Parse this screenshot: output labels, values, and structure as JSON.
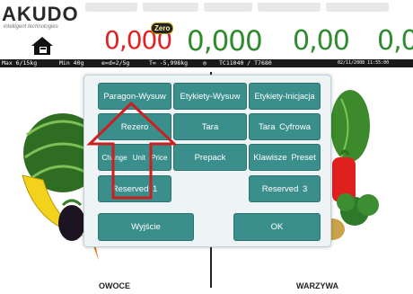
{
  "header": {
    "logo_text": "AKUDO",
    "logo_subtext": "intelligent technologies",
    "zero_badge": "Zero",
    "display_values": [
      "0,000",
      "0,000",
      "0,00",
      "0,0"
    ]
  },
  "status_bar": {
    "range": "Max 6/15kg",
    "min": "Min 40g",
    "division": "e=d=2/5g",
    "tare": "T= -5,998kg",
    "terminal": "TC11040 / T7680",
    "date": "02/11/2008 11:55:00"
  },
  "dialog": {
    "buttons": [
      "Paragon-Wysuw",
      "Etykiety-Wysuw",
      "Etykiety-Inicjacja",
      "Rezero",
      "Tara",
      "Tara Cyfrowa",
      "Change Unit Price",
      "Prepack",
      "Klawisze Preset",
      "Reserved 1",
      "Reserved 3"
    ],
    "exit_label": "Wyjście",
    "ok_label": "OK"
  },
  "categories": {
    "left": "OWOCE",
    "right": "WARZYWA"
  },
  "colors": {
    "button": "#3a8f8c",
    "value_red": "#e02222",
    "value_green": "#2e8b2e",
    "arrow": "#cc1f1f"
  }
}
